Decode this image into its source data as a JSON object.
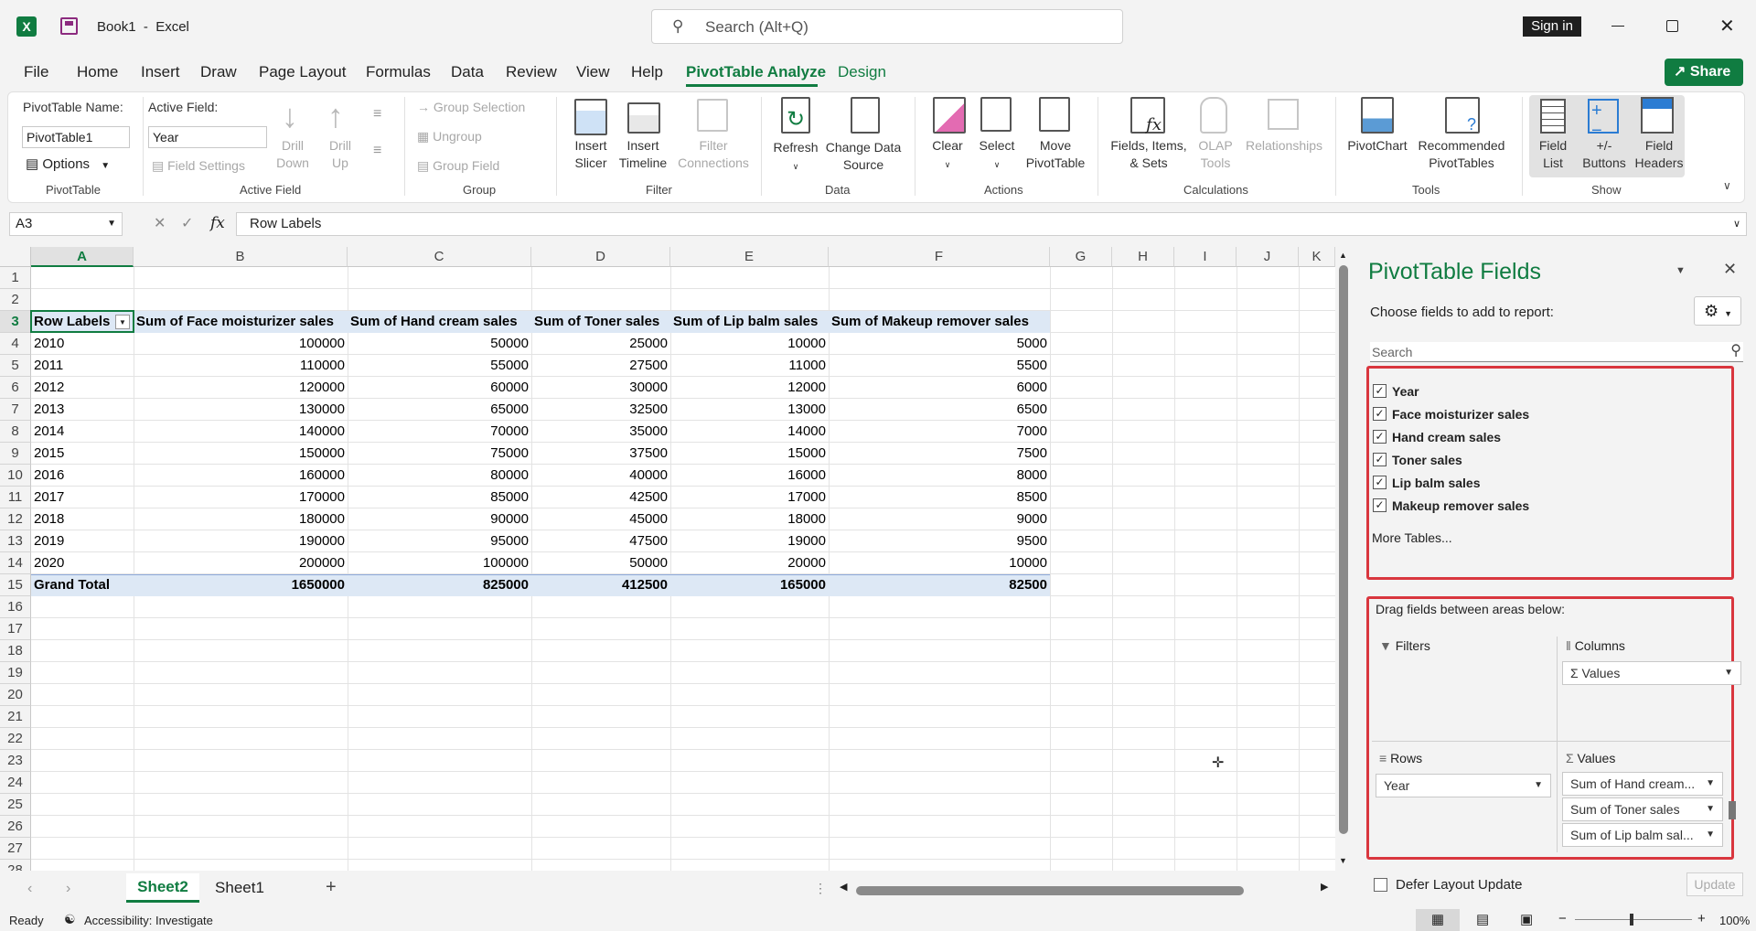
{
  "app": {
    "title": "Book1  -  Excel",
    "search_placeholder": "Search (Alt+Q)",
    "sign_in": "Sign in",
    "share": "Share"
  },
  "menu": [
    "File",
    "Home",
    "Insert",
    "Draw",
    "Page Layout",
    "Formulas",
    "Data",
    "Review",
    "View",
    "Help",
    "PivotTable Analyze",
    "Design"
  ],
  "ribbon": {
    "pt_name_label": "PivotTable Name:",
    "pt_name_value": "PivotTable1",
    "options": "Options",
    "group_pivottable": "PivotTable",
    "active_field_label": "Active Field:",
    "active_field_value": "Year",
    "field_settings": "Field Settings",
    "drill_down": "Drill\nDown",
    "drill_up": "Drill\nUp",
    "group_active_field": "Active Field",
    "group_selection": "Group Selection",
    "ungroup": "Ungroup",
    "group_field": "Group Field",
    "group_group": "Group",
    "insert_slicer": "Insert\nSlicer",
    "insert_timeline": "Insert\nTimeline",
    "filter_connections": "Filter\nConnections",
    "group_filter": "Filter",
    "refresh": "Refresh",
    "change_data_source": "Change Data\nSource",
    "group_data": "Data",
    "clear": "Clear",
    "select": "Select",
    "move_pivottable": "Move\nPivotTable",
    "group_actions": "Actions",
    "fields_items_sets": "Fields, Items,\n& Sets",
    "olap_tools": "OLAP\nTools",
    "relationships": "Relationships",
    "group_calculations": "Calculations",
    "pivotchart": "PivotChart",
    "recommended_pivottables": "Recommended\nPivotTables",
    "group_tools": "Tools",
    "field_list": "Field\nList",
    "buttons": "+/-\nButtons",
    "field_headers": "Field\nHeaders",
    "group_show": "Show"
  },
  "formula_bar": {
    "name_box": "A3",
    "fx": "fx",
    "content": "Row Labels"
  },
  "grid": {
    "columns": [
      "A",
      "B",
      "C",
      "D",
      "E",
      "F",
      "G",
      "H",
      "I",
      "J",
      "K"
    ],
    "rows": [
      "1",
      "2",
      "3",
      "4",
      "5",
      "6",
      "7",
      "8",
      "9",
      "10",
      "11",
      "12",
      "13",
      "14",
      "15",
      "16",
      "17",
      "18",
      "19",
      "20",
      "21",
      "22",
      "23",
      "24",
      "25",
      "26",
      "27",
      "28"
    ],
    "headers": [
      "Row Labels",
      "Sum of Face moisturizer sales",
      "Sum of Hand cream sales",
      "Sum of Toner sales",
      "Sum of Lip balm sales",
      "Sum of Makeup remover sales"
    ],
    "data": [
      [
        "2010",
        "100000",
        "50000",
        "25000",
        "10000",
        "5000"
      ],
      [
        "2011",
        "110000",
        "55000",
        "27500",
        "11000",
        "5500"
      ],
      [
        "2012",
        "120000",
        "60000",
        "30000",
        "12000",
        "6000"
      ],
      [
        "2013",
        "130000",
        "65000",
        "32500",
        "13000",
        "6500"
      ],
      [
        "2014",
        "140000",
        "70000",
        "35000",
        "14000",
        "7000"
      ],
      [
        "2015",
        "150000",
        "75000",
        "37500",
        "15000",
        "7500"
      ],
      [
        "2016",
        "160000",
        "80000",
        "40000",
        "16000",
        "8000"
      ],
      [
        "2017",
        "170000",
        "85000",
        "42500",
        "17000",
        "8500"
      ],
      [
        "2018",
        "180000",
        "90000",
        "45000",
        "18000",
        "9000"
      ],
      [
        "2019",
        "190000",
        "95000",
        "47500",
        "19000",
        "9500"
      ],
      [
        "2020",
        "200000",
        "100000",
        "50000",
        "20000",
        "10000"
      ]
    ],
    "total": [
      "Grand Total",
      "1650000",
      "825000",
      "412500",
      "165000",
      "82500"
    ]
  },
  "sheets": {
    "tabs": [
      "Sheet2",
      "Sheet1"
    ],
    "add": "+"
  },
  "panel": {
    "title": "PivotTable Fields",
    "choose": "Choose fields to add to report:",
    "search_placeholder": "Search",
    "fields": [
      "Year",
      "Face moisturizer sales",
      "Hand cream sales",
      "Toner sales",
      "Lip balm sales",
      "Makeup remover sales"
    ],
    "more_tables": "More Tables...",
    "drag_label": "Drag fields between areas below:",
    "filters": "Filters",
    "columns": "Columns",
    "rows": "Rows",
    "values": "Values",
    "columns_item": "Values",
    "rows_item": "Year",
    "values_items": [
      "Sum of Hand cream...",
      "Sum of Toner sales",
      "Sum of Lip balm sal..."
    ],
    "defer": "Defer Layout Update",
    "update": "Update"
  },
  "status": {
    "ready": "Ready",
    "accessibility": "Accessibility: Investigate",
    "zoom": "100%"
  },
  "colors": {
    "accent": "#107c41",
    "highlight_red": "#d9363e",
    "pivot_header": "#dde8f5"
  }
}
